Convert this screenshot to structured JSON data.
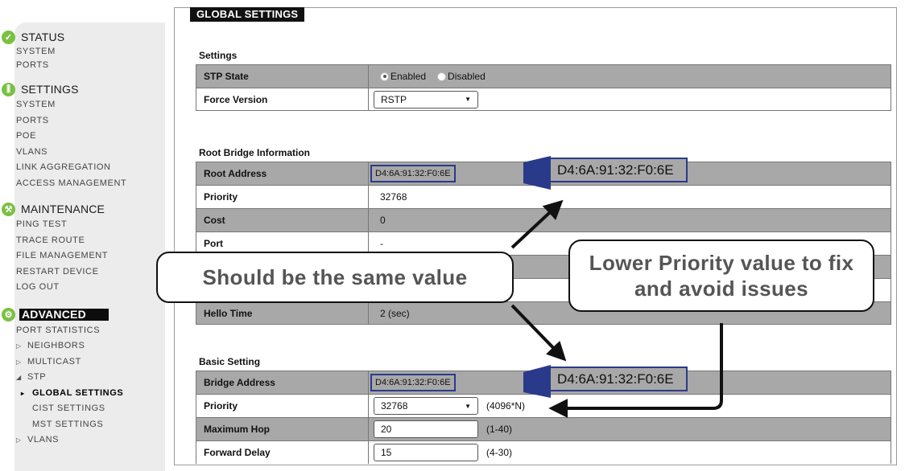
{
  "tab": {
    "label": "GLOBAL SETTINGS"
  },
  "sidebar": {
    "status": {
      "label": "STATUS",
      "items": [
        "SYSTEM",
        "PORTS"
      ]
    },
    "settings": {
      "label": "SETTINGS",
      "items": [
        "SYSTEM",
        "PORTS",
        "POE",
        "VLANS",
        "LINK AGGREGATION",
        "ACCESS MANAGEMENT"
      ]
    },
    "maintenance": {
      "label": "MAINTENANCE",
      "items": [
        "PING TEST",
        "TRACE ROUTE",
        "FILE MANAGEMENT",
        "RESTART DEVICE",
        "LOG OUT"
      ]
    },
    "advanced": {
      "label": "ADVANCED",
      "items": [
        {
          "label": "PORT STATISTICS"
        },
        {
          "label": "NEIGHBORS"
        },
        {
          "label": "MULTICAST"
        },
        {
          "label": "STP"
        },
        {
          "label": "GLOBAL SETTINGS"
        },
        {
          "label": "CIST SETTINGS"
        },
        {
          "label": "MST SETTINGS"
        },
        {
          "label": "VLANS"
        }
      ]
    }
  },
  "settings_section": {
    "title": "Settings",
    "stp_state": {
      "label": "STP State",
      "option_enabled": "Enabled",
      "option_disabled": "Disabled",
      "selected": "Enabled"
    },
    "force_version": {
      "label": "Force Version",
      "value": "RSTP"
    }
  },
  "root_bridge": {
    "title": "Root Bridge Information",
    "root_address": {
      "label": "Root Address",
      "value": "D4:6A:91:32:F0:6E"
    },
    "priority": {
      "label": "Priority",
      "value": "32768"
    },
    "cost": {
      "label": "Cost",
      "value": "0"
    },
    "port": {
      "label": "Port",
      "value": "-"
    },
    "hello_time": {
      "label": "Hello Time",
      "value": "2 (sec)"
    }
  },
  "basic_setting": {
    "title": "Basic Setting",
    "bridge_address": {
      "label": "Bridge Address",
      "value": "D4:6A:91:32:F0:6E"
    },
    "priority": {
      "label": "Priority",
      "value": "32768",
      "hint": "(4096*N)"
    },
    "maximum_hop": {
      "label": "Maximum Hop",
      "value": "20",
      "hint": "(1-40)"
    },
    "forward_delay": {
      "label": "Forward Delay",
      "value": "15",
      "hint": "(4-30)"
    }
  },
  "annotations": {
    "zoom_root_address": "D4:6A:91:32:F0:6E",
    "zoom_bridge_address": "D4:6A:91:32:F0:6E",
    "same_value_note": "Should be the same value",
    "priority_note": "Lower Priority value to fix and avoid issues"
  },
  "colors": {
    "accent": "#7bc043",
    "row_gray": "#a8a8a8",
    "highlight": "#2a3a8a"
  }
}
